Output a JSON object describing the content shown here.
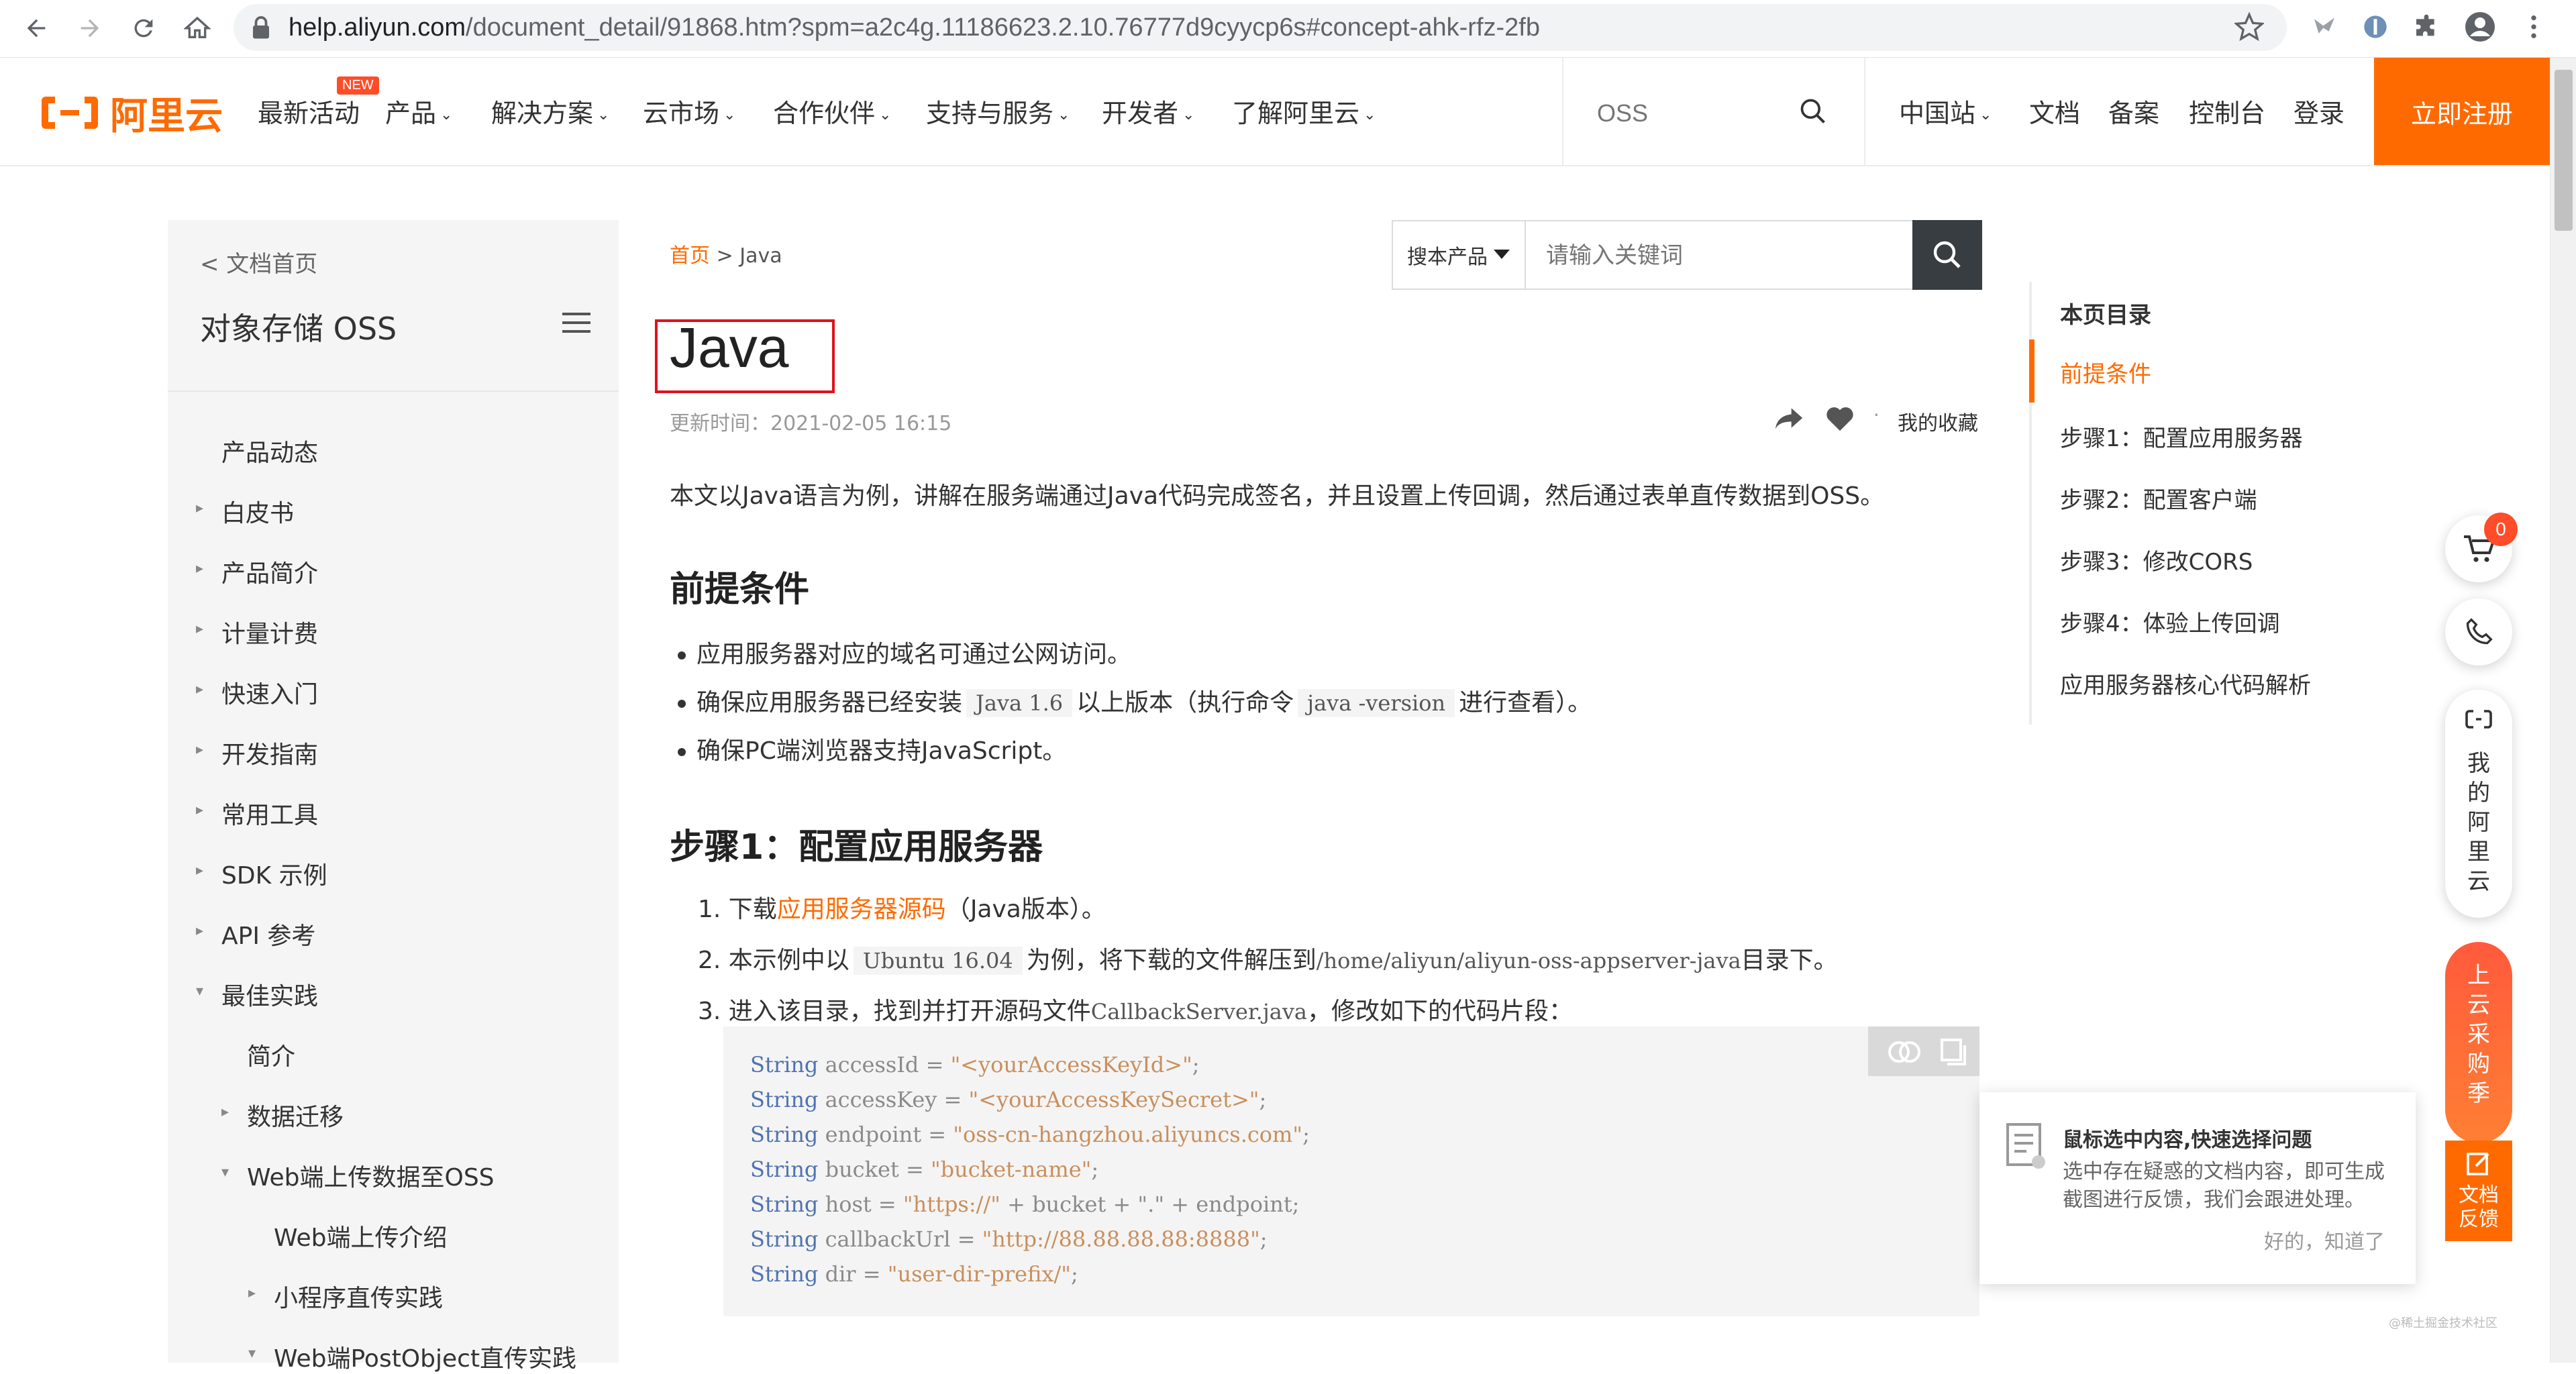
{
  "browser": {
    "url_domain": "help.aliyun.com",
    "url_path": "/document_detail/91868.htm?spm=a2c4g.11186623.2.10.76777d9cyycp6s#concept-ahk-rfz-2fb"
  },
  "header": {
    "logo_text": "阿里云",
    "new_badge": "NEW",
    "nav": [
      "最新活动",
      "产品",
      "解决方案",
      "云市场",
      "合作伙伴",
      "支持与服务",
      "开发者",
      "了解阿里云"
    ],
    "search_placeholder": "OSS",
    "right_links": [
      "中国站",
      "文档",
      "备案",
      "控制台",
      "登录"
    ],
    "signup": "立即注册"
  },
  "sidebar": {
    "back": "< 文档首页",
    "product": "对象存储 OSS",
    "items": [
      {
        "label": "产品动态"
      },
      {
        "label": "白皮书"
      },
      {
        "label": "产品简介"
      },
      {
        "label": "计量计费"
      },
      {
        "label": "快速入门"
      },
      {
        "label": "开发指南"
      },
      {
        "label": "常用工具"
      },
      {
        "label": "SDK 示例"
      },
      {
        "label": "API 参考"
      },
      {
        "label": "最佳实践"
      },
      {
        "label": "简介"
      },
      {
        "label": "数据迁移"
      },
      {
        "label": "Web端上传数据至OSS"
      },
      {
        "label": "Web端上传介绍"
      },
      {
        "label": "小程序直传实践"
      },
      {
        "label": "Web端PostObject直传实践"
      }
    ]
  },
  "main": {
    "breadcrumb_home": "首页",
    "breadcrumb_sep": " > ",
    "breadcrumb_current": "Java",
    "search_scope": "搜本产品",
    "search_placeholder": "请输入关键词",
    "title": "Java",
    "updated": "更新时间：2021-02-05 16:15",
    "dot": "·",
    "favorite": "我的收藏",
    "intro": "本文以Java语言为例，讲解在服务端通过Java代码完成签名，并且设置上传回调，然后通过表单直传数据到OSS。",
    "prereq_title": "前提条件",
    "prereq": {
      "b1": "应用服务器对应的域名可通过公网访问。",
      "b2_pre": "确保应用服务器已经安装",
      "b2_code1": "Java 1.6",
      "b2_mid": "以上版本（执行命令",
      "b2_code2": "java -version",
      "b2_post": "进行查看）。",
      "b3": "确保PC端浏览器支持JavaScript。"
    },
    "step1_title": "步骤1：配置应用服务器",
    "step1": {
      "s1_pre": "1. 下载",
      "s1_link": "应用服务器源码",
      "s1_post": "（Java版本）。",
      "s2_pre": "2. 本示例中以",
      "s2_code": "Ubuntu 16.04",
      "s2_mid": "为例，将下载的文件解压到",
      "s2_path": "/home/aliyun/aliyun-oss-appserver-java",
      "s2_post": "目录下。",
      "s3_pre": "3. 进入该目录，找到并打开源码文件",
      "s3_file": "CallbackServer.java",
      "s3_post": "，修改如下的代码片段："
    },
    "code": [
      {
        "kw": "String",
        "rest": " accessId = ",
        "str": "\"<yourAccessKeyId>\"",
        "end": ";"
      },
      {
        "kw": "String",
        "rest": " accessKey = ",
        "str": "\"<yourAccessKeySecret>\"",
        "end": ";"
      },
      {
        "kw": "String",
        "rest": " endpoint = ",
        "str": "\"oss-cn-hangzhou.aliyuncs.com\"",
        "end": ";"
      },
      {
        "kw": "String",
        "rest": " bucket = ",
        "str": "\"bucket-name\"",
        "end": ";"
      },
      {
        "kw": "String",
        "rest": " host = ",
        "str": "\"https://\"",
        "end": " + bucket + \".\" + endpoint;"
      },
      {
        "kw": "String",
        "rest": " callbackUrl = ",
        "str": "\"http://88.88.88.88:8888\"",
        "end": ";"
      },
      {
        "kw": "String",
        "rest": " dir = ",
        "str": "\"user-dir-prefix/\"",
        "end": ";"
      }
    ]
  },
  "toc": {
    "title": "本页目录",
    "items": [
      "前提条件",
      "步骤1：配置应用服务器",
      "步骤2：配置客户端",
      "步骤3：修改CORS",
      "步骤4：体验上传回调",
      "应用服务器核心代码解析"
    ],
    "active_index": 0
  },
  "floating": {
    "cart_count": "0",
    "my_aliyun": "我的阿里云",
    "promo": "上云采购季",
    "feedback_line1": "文档",
    "feedback_line2": "反馈",
    "tip_title": "鼠标选中内容,快速选择问题",
    "tip_body": "选中存在疑惑的文档内容，即可生成截图进行反馈，我们会跟进处理。",
    "tip_ok": "好的，知道了"
  },
  "watermark": "@稀土掘金技术社区",
  "colors": {
    "accent": "#ff6a00",
    "title_box": "#e0111b",
    "code_keyword": "#4f73b0",
    "code_string": "#c98f5c"
  }
}
